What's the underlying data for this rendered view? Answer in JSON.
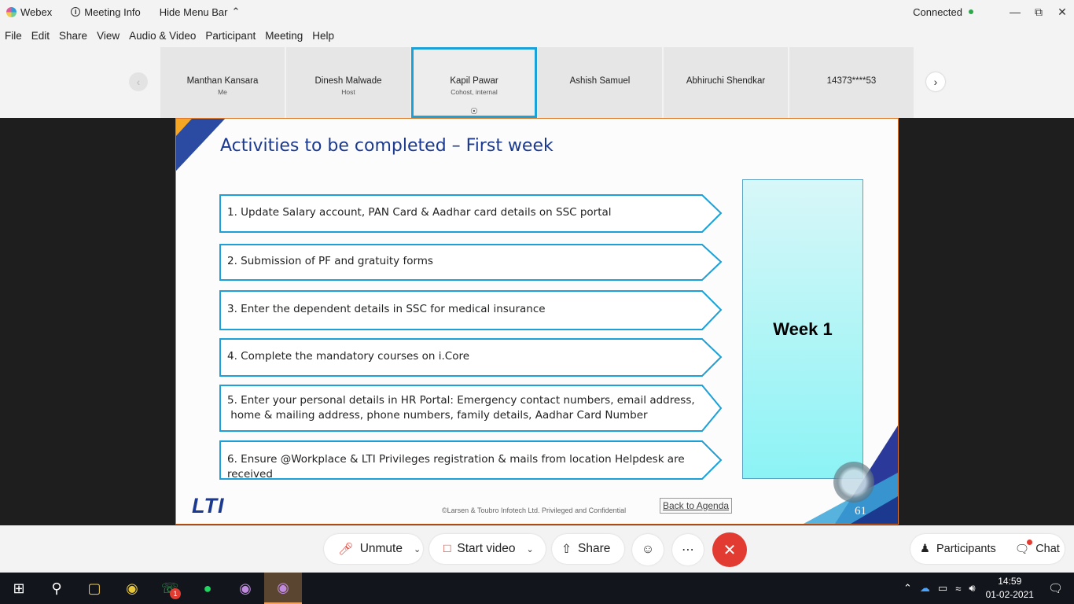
{
  "titlebar": {
    "app_name": "Webex",
    "meeting_info": "Meeting Info",
    "hide_menu": "Hide Menu Bar",
    "status": "Connected"
  },
  "menu": [
    "File",
    "Edit",
    "Share",
    "View",
    "Audio & Video",
    "Participant",
    "Meeting",
    "Help"
  ],
  "participants": [
    {
      "name": "Manthan Kansara",
      "role": "Me"
    },
    {
      "name": "Dinesh Malwade",
      "role": "Host"
    },
    {
      "name": "Kapil Pawar",
      "role": "Cohost, internal"
    },
    {
      "name": "Ashish Samuel",
      "role": ""
    },
    {
      "name": "Abhiruchi Shendkar",
      "role": ""
    },
    {
      "name": "14373****53",
      "role": ""
    }
  ],
  "slide": {
    "title": "Activities to be completed – First week",
    "items": [
      "1. Update Salary account, PAN Card & Aadhar card details on SSC portal",
      "2. Submission of PF and gratuity forms",
      "3. Enter the dependent details in SSC for medical insurance",
      "4. Complete the mandatory courses on i.Core",
      "5. Enter your personal details in HR Portal: Emergency contact numbers, email address,",
      " home & mailing address, phone numbers, family details, Aadhar Card Number",
      "6. Ensure @Workplace & LTI Privileges registration & mails from location Helpdesk are received"
    ],
    "week_label": "Week 1",
    "logo": "LTI",
    "copyright": "©Larsen & Toubro Infotech Ltd. Privileged and Confidential",
    "back_link": "Back to Agenda",
    "page_number": "61"
  },
  "controls": {
    "unmute": "Unmute",
    "start_video": "Start video",
    "share": "Share",
    "participants": "Participants",
    "chat": "Chat"
  },
  "taskbar": {
    "whatsapp_badge": "1",
    "time": "14:59",
    "date": "01-02-2021"
  },
  "colors": {
    "accent": "#1ba0d7",
    "slide_title": "#1b3a8f",
    "end_call": "#e23b31",
    "slide_border": "#e07a2b"
  }
}
